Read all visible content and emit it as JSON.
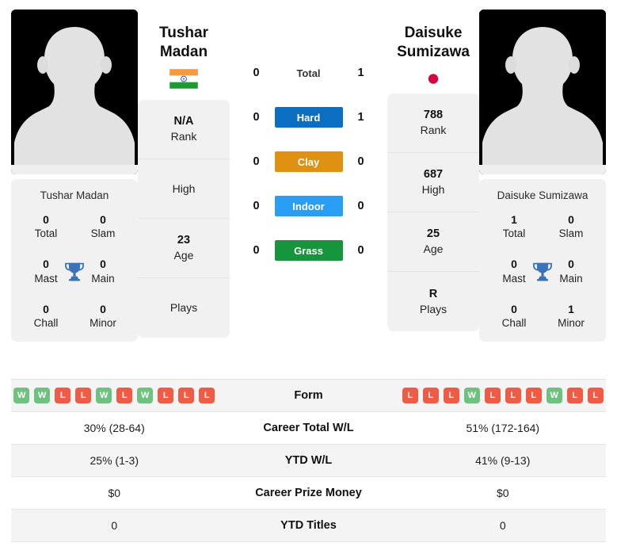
{
  "players": {
    "left": {
      "first_name": "Tushar",
      "last_name": "Madan",
      "full_name": "Tushar Madan",
      "flag_icon": "flag-india-icon",
      "flag_name": "India",
      "rank": "N/A",
      "rank_label": "Rank",
      "high": "",
      "high_label": "High",
      "age": "23",
      "age_label": "Age",
      "plays": "",
      "plays_label": "Plays",
      "titles": {
        "total": "0",
        "total_label": "Total",
        "slam": "0",
        "slam_label": "Slam",
        "mast": "0",
        "mast_label": "Mast",
        "main": "0",
        "main_label": "Main",
        "chall": "0",
        "chall_label": "Chall",
        "minor": "0",
        "minor_label": "Minor"
      },
      "form": [
        "W",
        "W",
        "L",
        "L",
        "W",
        "L",
        "W",
        "L",
        "L",
        "L"
      ],
      "career_total_wl": "30% (28-64)",
      "ytd_wl": "25% (1-3)",
      "career_prize_money": "$0",
      "ytd_titles": "0"
    },
    "right": {
      "first_name": "Daisuke",
      "last_name": "Sumizawa",
      "full_name": "Daisuke Sumizawa",
      "flag_icon": "flag-japan-icon",
      "flag_name": "Japan",
      "rank": "788",
      "rank_label": "Rank",
      "high": "687",
      "high_label": "High",
      "age": "25",
      "age_label": "Age",
      "plays": "R",
      "plays_label": "Plays",
      "titles": {
        "total": "1",
        "total_label": "Total",
        "slam": "0",
        "slam_label": "Slam",
        "mast": "0",
        "mast_label": "Mast",
        "main": "0",
        "main_label": "Main",
        "chall": "0",
        "chall_label": "Chall",
        "minor": "1",
        "minor_label": "Minor"
      },
      "form": [
        "L",
        "L",
        "L",
        "W",
        "L",
        "L",
        "L",
        "W",
        "L",
        "L"
      ],
      "career_total_wl": "51% (172-164)",
      "ytd_wl": "41% (9-13)",
      "career_prize_money": "$0",
      "ytd_titles": "0"
    }
  },
  "head_to_head": [
    {
      "label": "Total",
      "left": "0",
      "right": "1",
      "color": "",
      "style": "plain"
    },
    {
      "label": "Hard",
      "left": "0",
      "right": "1",
      "color": "#0a6fc2",
      "style": "pill"
    },
    {
      "label": "Clay",
      "left": "0",
      "right": "0",
      "color": "#e09112",
      "style": "pill"
    },
    {
      "label": "Indoor",
      "left": "0",
      "right": "0",
      "color": "#2a9df4",
      "style": "pill"
    },
    {
      "label": "Grass",
      "left": "0",
      "right": "0",
      "color": "#17953c",
      "style": "pill"
    }
  ],
  "stats_table": [
    {
      "key": "form",
      "label": "Form",
      "type": "form",
      "shaded": true
    },
    {
      "key": "ctwl",
      "label": "Career Total W/L",
      "type": "text",
      "left": "30% (28-64)",
      "right": "51% (172-164)",
      "shaded": false
    },
    {
      "key": "ytdwl",
      "label": "YTD W/L",
      "type": "text",
      "left": "25% (1-3)",
      "right": "41% (9-13)",
      "shaded": true
    },
    {
      "key": "cpm",
      "label": "Career Prize Money",
      "type": "text",
      "left": "$0",
      "right": "$0",
      "shaded": false
    },
    {
      "key": "ytdt",
      "label": "YTD Titles",
      "type": "text",
      "left": "0",
      "right": "0",
      "shaded": true
    }
  ],
  "colors": {
    "hard": "#0a6fc2",
    "clay": "#e09112",
    "indoor": "#2a9df4",
    "grass": "#17953c",
    "win_badge": "#6fc180",
    "loss_badge": "#ef5b45",
    "card_bg": "#f1f1f1",
    "trophy": "#3b72b8"
  }
}
